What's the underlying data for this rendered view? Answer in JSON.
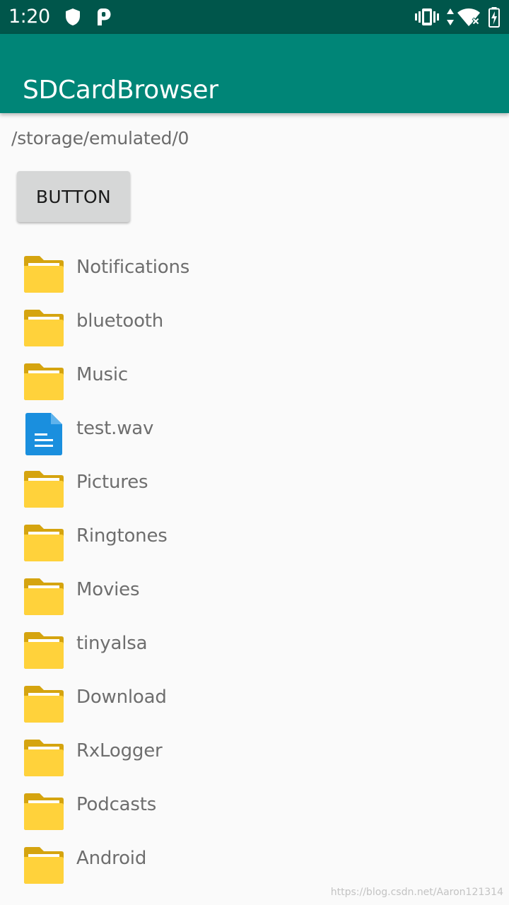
{
  "status_bar": {
    "time": "1:20",
    "icons": [
      "shield-icon",
      "p-icon",
      "vibrate-icon",
      "data-arrows-icon",
      "wifi-icon",
      "battery-charging-icon"
    ]
  },
  "app_bar": {
    "title": "SDCardBrowser",
    "color": "#008577"
  },
  "path": "/storage/emulated/0",
  "button_label": "BUTTON",
  "files": [
    {
      "name": "Notifications",
      "type": "folder"
    },
    {
      "name": "bluetooth",
      "type": "folder"
    },
    {
      "name": "Music",
      "type": "folder"
    },
    {
      "name": "test.wav",
      "type": "file"
    },
    {
      "name": "Pictures",
      "type": "folder"
    },
    {
      "name": "Ringtones",
      "type": "folder"
    },
    {
      "name": "Movies",
      "type": "folder"
    },
    {
      "name": "tinyalsa",
      "type": "folder"
    },
    {
      "name": "Download",
      "type": "folder"
    },
    {
      "name": "RxLogger",
      "type": "folder"
    },
    {
      "name": "Podcasts",
      "type": "folder"
    },
    {
      "name": "Android",
      "type": "folder"
    }
  ],
  "colors": {
    "status_bar": "#00564b",
    "folder": "#ffd23b",
    "folder_tab": "#d5a40f",
    "file": "#1a8fde"
  },
  "watermark": "https://blog.csdn.net/Aaron121314"
}
